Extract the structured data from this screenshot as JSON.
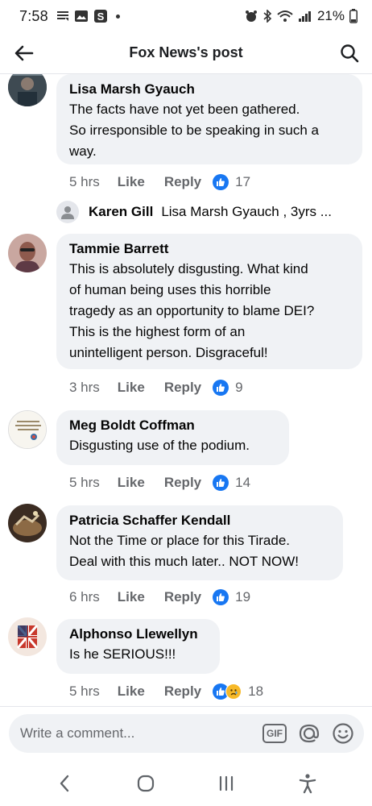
{
  "status_bar": {
    "time": "7:58",
    "battery": "21%"
  },
  "header": {
    "title": "Fox News's post"
  },
  "comments": [
    {
      "author": "Lisa Marsh Gyauch",
      "lines": [
        "The facts have not yet been gathered.",
        "So irresponsible to be speaking in such a",
        "way."
      ],
      "time": "5 hrs",
      "like": "Like",
      "reply": "Reply",
      "reaction_count": "17",
      "reactions": [
        "like"
      ]
    },
    {
      "author": "Tammie Barrett",
      "lines": [
        "This is absolutely disgusting.  What kind",
        "of human being uses this horrible",
        "tragedy as an opportunity to blame DEI?",
        "This is the highest form of an",
        "unintelligent person.  Disgraceful!"
      ],
      "time": "3 hrs",
      "like": "Like",
      "reply": "Reply",
      "reaction_count": "9",
      "reactions": [
        "like"
      ]
    },
    {
      "author": "Meg Boldt Coffman",
      "lines": [
        "Disgusting use of the podium."
      ],
      "time": "5 hrs",
      "like": "Like",
      "reply": "Reply",
      "reaction_count": "14",
      "reactions": [
        "like"
      ]
    },
    {
      "author": "Patricia Schaffer Kendall",
      "lines": [
        "Not the Time or place for this Tirade.",
        "Deal with this much later..  NOT NOW!"
      ],
      "time": "6 hrs",
      "like": "Like",
      "reply": "Reply",
      "reaction_count": "19",
      "reactions": [
        "like"
      ]
    },
    {
      "author": "Alphonso Llewellyn",
      "lines": [
        "Is he SERIOUS!!!"
      ],
      "time": "5 hrs",
      "like": "Like",
      "reply": "Reply",
      "reaction_count": "18",
      "reactions": [
        "like",
        "sad"
      ]
    }
  ],
  "reply_preview": {
    "author": "Karen Gill",
    "snippet": "Lisa Marsh Gyauch , 3yrs ..."
  },
  "compose": {
    "placeholder": "Write a comment...",
    "gif_label": "GIF"
  },
  "colors": {
    "accent": "#1877f2",
    "bubble": "#f0f2f5",
    "meta_text": "#65676b",
    "sad_reaction": "#f7b928"
  }
}
